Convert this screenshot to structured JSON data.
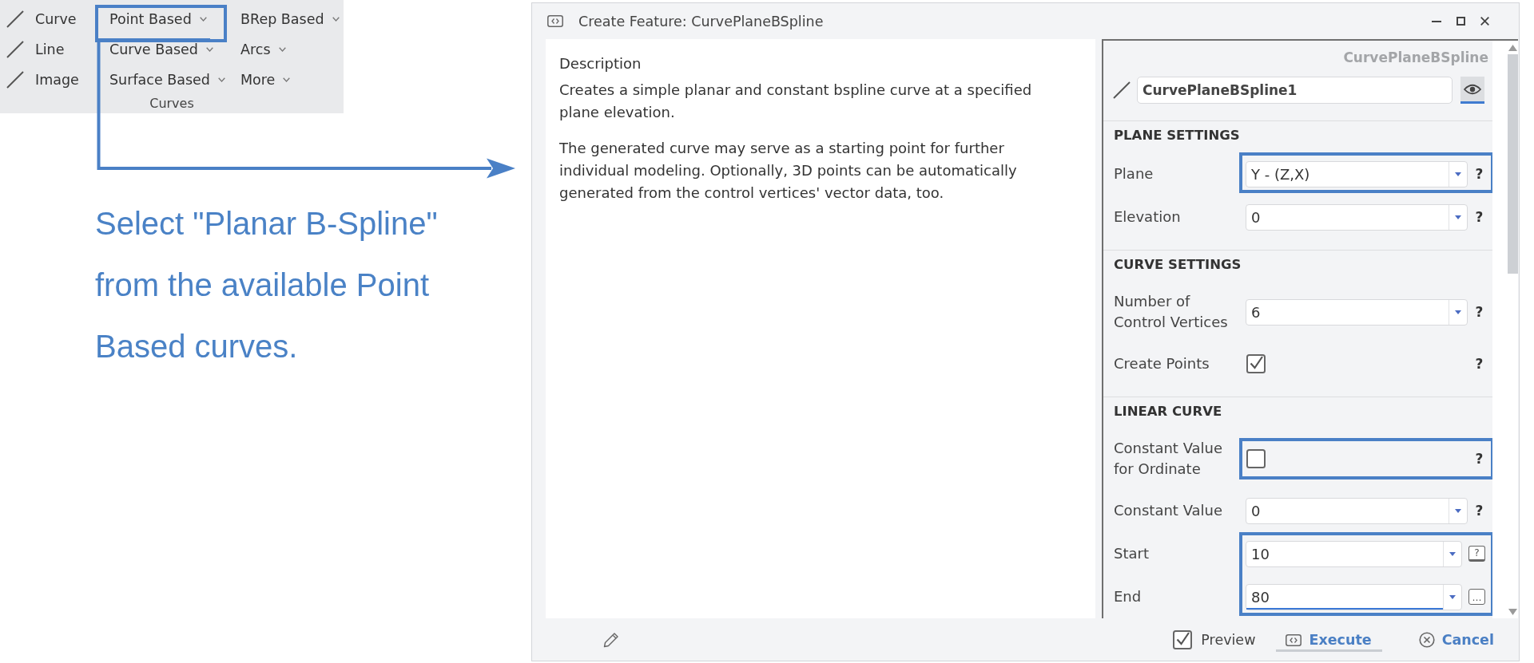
{
  "ribbon": {
    "columns": [
      {
        "items": [
          {
            "label": "Curve",
            "kind": "tool",
            "selected": false,
            "highlighted": false
          },
          {
            "label": "Line",
            "kind": "tool",
            "selected": false,
            "highlighted": false
          },
          {
            "label": "Image",
            "kind": "tool",
            "selected": false,
            "highlighted": false
          }
        ]
      },
      {
        "items": [
          {
            "label": "Point Based",
            "kind": "menu",
            "selected": true,
            "highlighted": true
          },
          {
            "label": "Curve Based",
            "kind": "menu",
            "selected": false,
            "highlighted": false
          },
          {
            "label": "Surface Based",
            "kind": "menu",
            "selected": false,
            "highlighted": false
          }
        ]
      },
      {
        "items": [
          {
            "label": "BRep Based",
            "kind": "menu",
            "selected": false,
            "highlighted": false
          },
          {
            "label": "Arcs",
            "kind": "menu",
            "selected": false,
            "highlighted": false
          },
          {
            "label": "More",
            "kind": "menu",
            "selected": false,
            "highlighted": false
          }
        ]
      }
    ],
    "group_label": "Curves"
  },
  "annotation": {
    "text": "Select \"Planar B-Spline\" from the available Point Based curves."
  },
  "dialog": {
    "title": "Create Feature: CurvePlaneBSpline",
    "description": {
      "heading": "Description",
      "paragraphs": [
        "Creates a simple planar and constant bspline curve at a specified plane elevation.",
        "The generated curve may serve as a starting point for further individual modeling. Optionally, 3D points can be automatically generated from the control vertices' vector data, too."
      ]
    },
    "panel": {
      "type_label": "CurvePlaneBSpline",
      "name": "CurvePlaneBSpline1",
      "visibility": {
        "on": true
      },
      "sections": [
        {
          "title": "PLANE SETTINGS",
          "rows": [
            {
              "label": "Plane",
              "kind": "dropdown",
              "value": "Y - (Z,X)",
              "focused": false,
              "highlighted": true,
              "side": {
                "kind": "help",
                "text": "?"
              }
            },
            {
              "label": "Elevation",
              "kind": "dropdown",
              "value": "0",
              "focused": false,
              "highlighted": false,
              "side": {
                "kind": "help",
                "text": "?"
              }
            }
          ]
        },
        {
          "title": "CURVE SETTINGS",
          "rows": [
            {
              "label": "Number of Control Vertices",
              "kind": "dropdown",
              "value": "6",
              "focused": false,
              "highlighted": false,
              "side": {
                "kind": "help",
                "text": "?"
              }
            },
            {
              "label": "Create Points",
              "kind": "checkbox",
              "checked": true,
              "focused": false,
              "highlighted": false,
              "side": {
                "kind": "help",
                "text": "?"
              }
            }
          ]
        },
        {
          "title": "LINEAR CURVE",
          "rows": [
            {
              "label": "Constant Value for Ordinate",
              "kind": "checkbox",
              "checked": false,
              "focused": false,
              "highlighted": true,
              "side": {
                "kind": "help",
                "text": "?"
              }
            },
            {
              "label": "Constant Value",
              "kind": "dropdown",
              "value": "0",
              "focused": false,
              "highlighted": false,
              "side": {
                "kind": "help",
                "text": "?"
              }
            },
            {
              "label": "Start",
              "kind": "dropdown",
              "value": "10",
              "focused": false,
              "highlighted": true,
              "side": {
                "kind": "tip",
                "text": "?"
              }
            },
            {
              "label": "End",
              "kind": "dropdown",
              "value": "80",
              "focused": true,
              "highlighted": true,
              "side": {
                "kind": "more",
                "text": "…"
              }
            }
          ]
        }
      ]
    },
    "footer": {
      "preview": {
        "label": "Preview",
        "checked": true
      },
      "buttons": [
        {
          "label": "Execute",
          "kind": "execute",
          "default": true
        },
        {
          "label": "Cancel",
          "kind": "cancel",
          "default": false
        }
      ]
    }
  }
}
